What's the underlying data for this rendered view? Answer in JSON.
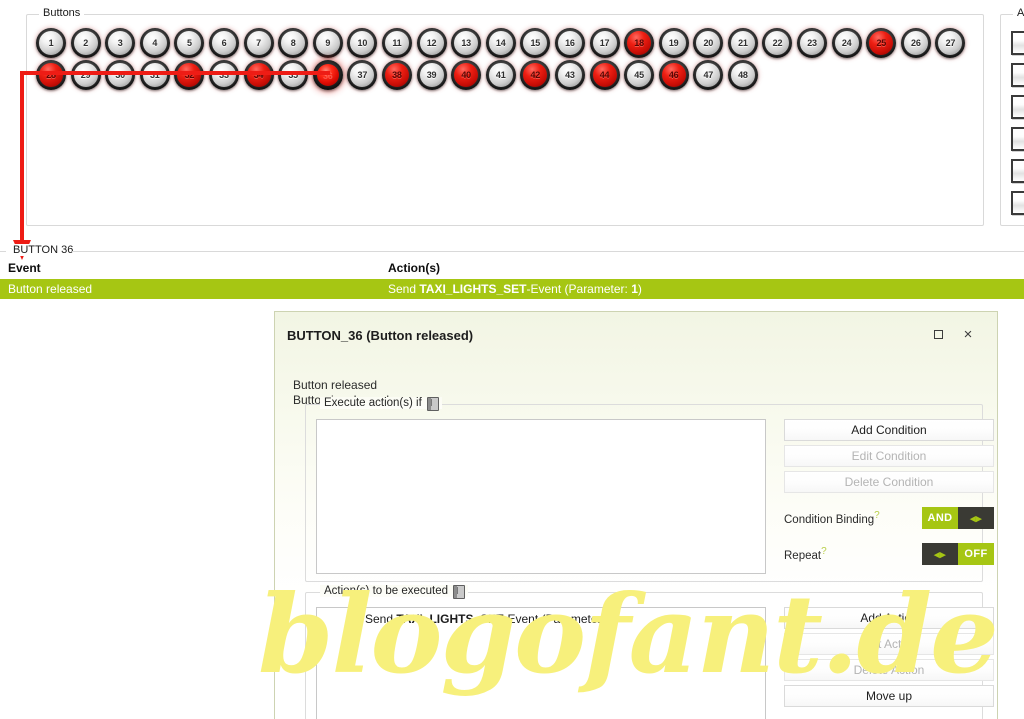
{
  "panels": {
    "buttons_legend": "Buttons",
    "axes_legend": "Axe"
  },
  "buttons": {
    "row1": [
      {
        "n": "1",
        "state": "grey"
      },
      {
        "n": "2",
        "state": "grey"
      },
      {
        "n": "3",
        "state": "grey"
      },
      {
        "n": "4",
        "state": "grey"
      },
      {
        "n": "5",
        "state": "grey"
      },
      {
        "n": "6",
        "state": "grey"
      },
      {
        "n": "7",
        "state": "grey"
      },
      {
        "n": "8",
        "state": "grey"
      },
      {
        "n": "9",
        "state": "grey"
      },
      {
        "n": "10",
        "state": "grey"
      },
      {
        "n": "11",
        "state": "grey"
      },
      {
        "n": "12",
        "state": "grey"
      },
      {
        "n": "13",
        "state": "grey"
      },
      {
        "n": "14",
        "state": "grey"
      },
      {
        "n": "15",
        "state": "grey"
      },
      {
        "n": "16",
        "state": "grey"
      },
      {
        "n": "17",
        "state": "grey"
      },
      {
        "n": "18",
        "state": "red"
      },
      {
        "n": "19",
        "state": "grey"
      },
      {
        "n": "20",
        "state": "grey"
      },
      {
        "n": "21",
        "state": "grey"
      },
      {
        "n": "22",
        "state": "grey"
      },
      {
        "n": "23",
        "state": "grey"
      },
      {
        "n": "24",
        "state": "grey"
      },
      {
        "n": "25",
        "state": "red"
      },
      {
        "n": "26",
        "state": "grey"
      },
      {
        "n": "27",
        "state": "grey"
      }
    ],
    "row2": [
      {
        "n": "28",
        "state": "red"
      },
      {
        "n": "29",
        "state": "grey"
      },
      {
        "n": "30",
        "state": "grey"
      },
      {
        "n": "31",
        "state": "grey"
      },
      {
        "n": "32",
        "state": "red"
      },
      {
        "n": "33",
        "state": "grey"
      },
      {
        "n": "34",
        "state": "red"
      },
      {
        "n": "35",
        "state": "grey"
      },
      {
        "n": "36",
        "state": "selected"
      },
      {
        "n": "37",
        "state": "grey"
      },
      {
        "n": "38",
        "state": "red"
      },
      {
        "n": "39",
        "state": "grey"
      },
      {
        "n": "40",
        "state": "red"
      },
      {
        "n": "41",
        "state": "grey"
      },
      {
        "n": "42",
        "state": "red"
      },
      {
        "n": "43",
        "state": "grey"
      },
      {
        "n": "44",
        "state": "red"
      },
      {
        "n": "45",
        "state": "grey"
      },
      {
        "n": "46",
        "state": "red"
      },
      {
        "n": "47",
        "state": "grey"
      },
      {
        "n": "48",
        "state": "grey"
      }
    ]
  },
  "axes": {
    "count": 6
  },
  "event_panel": {
    "legend": "BUTTON 36",
    "header_event": "Event",
    "header_actions": "Action(s)",
    "row": {
      "event": "Button released",
      "action_prefix": "Send ",
      "action_name": "TAXI_LIGHTS_SET",
      "action_suffix": "-Event (Parameter: ",
      "action_param": "1",
      "action_end": ")"
    }
  },
  "dialog": {
    "title": "BUTTON_36 (Button released)",
    "maximize_icon": "maximize-icon",
    "close_icon": "close-icon",
    "close_glyph": "×",
    "line1": "Button released",
    "line2": "Button is released",
    "condition_group": {
      "legend": "Execute action(s) if",
      "help_icon": "book-icon",
      "items": [],
      "buttons": [
        {
          "label": "Add Condition",
          "enabled": true
        },
        {
          "label": "Edit Condition",
          "enabled": false
        },
        {
          "label": "Delete Condition",
          "enabled": false
        }
      ],
      "toggles": [
        {
          "label": "Condition Binding",
          "marker": "?",
          "left": "AND",
          "right": "◂▸",
          "active": "left"
        },
        {
          "label": "Repeat",
          "marker": "?",
          "left": "◂▸",
          "right": "OFF",
          "active": "right"
        }
      ]
    },
    "action_group": {
      "legend": "Action(s) to be executed",
      "help_icon": "book-icon",
      "item": {
        "prefix": "Send ",
        "name": "TAXI_LIGHTS_SET",
        "suffix": "-Event (Parameter: ",
        "param": "1",
        "end": ")"
      },
      "buttons": [
        {
          "label": "Add Action",
          "enabled": true
        },
        {
          "label": "Edit Action",
          "enabled": false
        },
        {
          "label": "Delete Action",
          "enabled": false
        },
        {
          "label": "Move up",
          "enabled": true
        }
      ]
    }
  },
  "annotation": {
    "arrow_color": "#ee1c15",
    "from_label": "button-36",
    "to_label": "BUTTON 36"
  },
  "watermark": {
    "text": "blogofant.de",
    "color": "#f7f07c"
  },
  "colors": {
    "accent_green": "#a6c613",
    "toggle_dark": "#3a3a34",
    "red_button": "#d11108",
    "dialog_border": "#cdd3b2"
  }
}
